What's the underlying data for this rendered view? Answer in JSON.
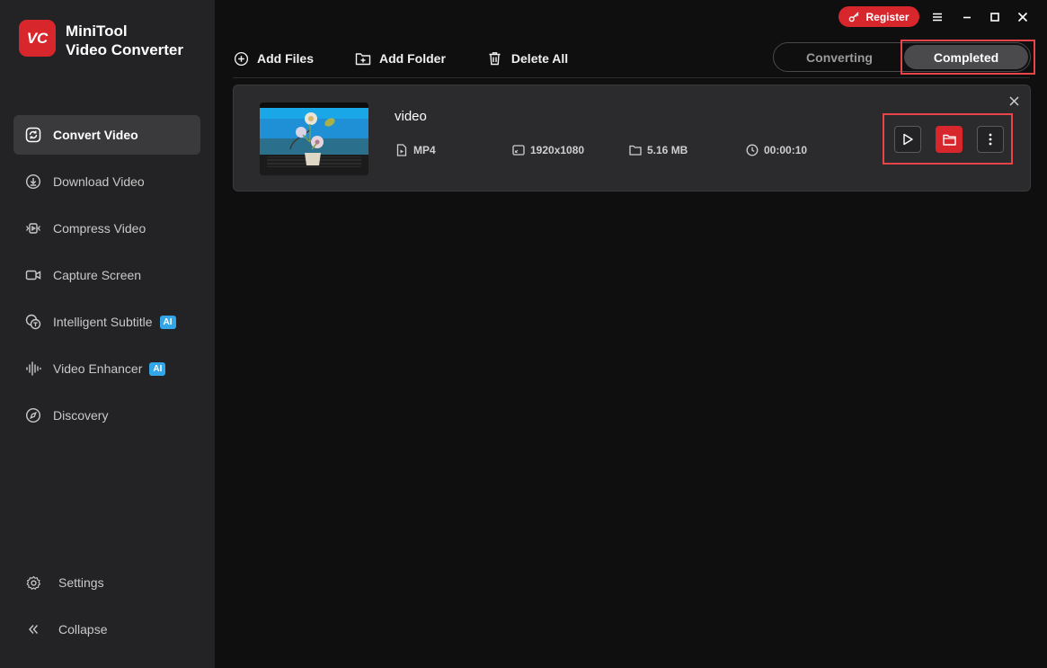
{
  "app": {
    "name_line1": "MiniTool",
    "name_line2": "Video Converter",
    "logo_text": "VC"
  },
  "titlebar": {
    "register_label": "Register"
  },
  "sidebar": {
    "items": [
      {
        "label": "Convert Video",
        "icon": "convert-icon",
        "active": true
      },
      {
        "label": "Download Video",
        "icon": "download-icon"
      },
      {
        "label": "Compress Video",
        "icon": "compress-icon"
      },
      {
        "label": "Capture Screen",
        "icon": "camera-icon"
      },
      {
        "label": "Intelligent Subtitle",
        "icon": "subtitle-icon",
        "badge": "AI"
      },
      {
        "label": "Video Enhancer",
        "icon": "waveform-icon",
        "badge": "AI"
      },
      {
        "label": "Discovery",
        "icon": "compass-icon"
      }
    ],
    "settings_label": "Settings",
    "collapse_label": "Collapse"
  },
  "toolbar": {
    "add_files": "Add Files",
    "add_folder": "Add Folder",
    "delete_all": "Delete All"
  },
  "tabs": {
    "converting": "Converting",
    "completed": "Completed",
    "selected": "Completed"
  },
  "file": {
    "name": "video",
    "format": "MP4",
    "resolution": "1920x1080",
    "size": "5.16 MB",
    "duration": "00:00:10"
  },
  "colors": {
    "accent": "#d8262d",
    "sidebar_bg": "#232325",
    "main_bg": "#0f0f10",
    "card_bg": "#2b2b2d",
    "ai_badge": "#33a6e8",
    "highlight": "#e8454a"
  }
}
